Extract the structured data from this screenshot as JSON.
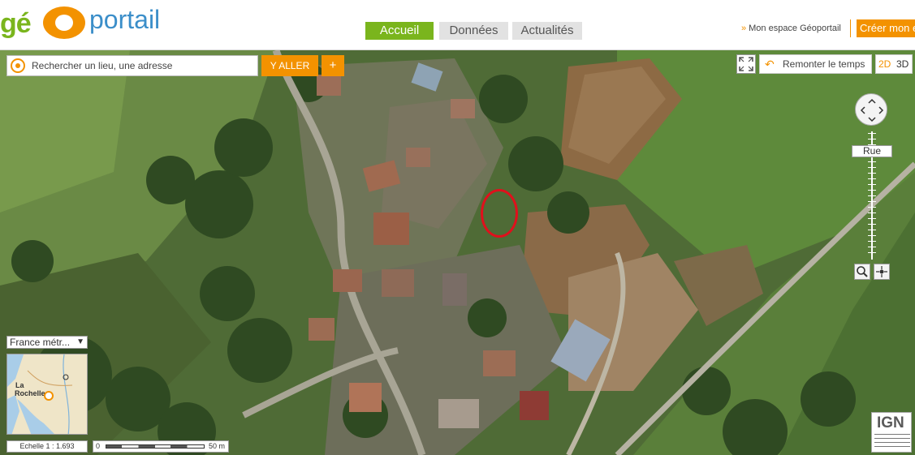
{
  "header": {
    "logo": {
      "ge": "gé",
      "o": "O",
      "portail": "portail"
    },
    "tabs": [
      {
        "label": "Accueil",
        "active": true
      },
      {
        "label": "Données",
        "active": false
      },
      {
        "label": "Actualités",
        "active": false
      }
    ],
    "account_link": "Mon espace Géoportail",
    "create_account": "Créer mon e"
  },
  "search": {
    "placeholder": "Rechercher un lieu, une adresse",
    "go_label": "Y ALLER",
    "more_label": "+"
  },
  "map_controls": {
    "time_travel_label": "Remonter le temps",
    "view_2d": "2D",
    "view_3d": "3D",
    "zoom_level_label": "Rue",
    "zoom_level_fraction": 0.15
  },
  "overview": {
    "projection": "France métr...",
    "labels": [
      "La",
      "Rochelle"
    ]
  },
  "scale": {
    "text": "Echelle 1 :  1.693",
    "zero": "0",
    "max": "50 m"
  },
  "ign": {
    "logo_text": "IGN",
    "subtitle": "INSTITUT NATIONAL DE L'INFORMATION GÉOGRAPHIQUE ET FORESTIÈRE"
  },
  "colors": {
    "accent_orange": "#f39200",
    "accent_green": "#7ab51d",
    "brand_blue": "#3b8ec9",
    "marker_red": "#e0101c"
  },
  "icons": {
    "search": "compass-icon",
    "fullscreen": "fullscreen-icon",
    "time": "back-arrow-icon",
    "pan": "pan-arrows-icon",
    "zoom_out": "magnifier-icon",
    "locate": "crosshair-icon"
  }
}
